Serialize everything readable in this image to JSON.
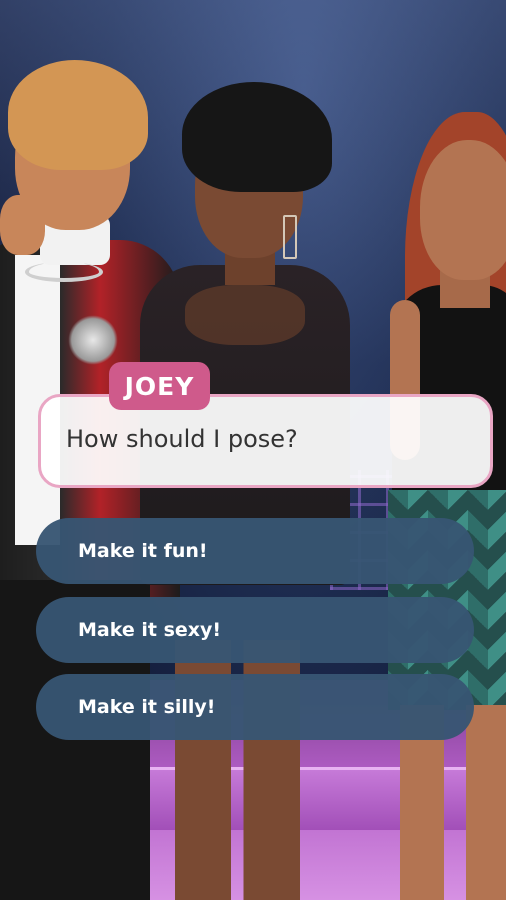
{
  "dialogue": {
    "speaker": "JOEY",
    "text": "How should I pose?"
  },
  "choices": [
    {
      "label": "Make it fun!"
    },
    {
      "label": "Make it sexy!"
    },
    {
      "label": "Make it silly!"
    }
  ],
  "colors": {
    "name_tag": "#cf5a8b",
    "speech_border": "#e9a6c4",
    "choice_bg": "#37556f",
    "choice_text": "#ffffff"
  }
}
